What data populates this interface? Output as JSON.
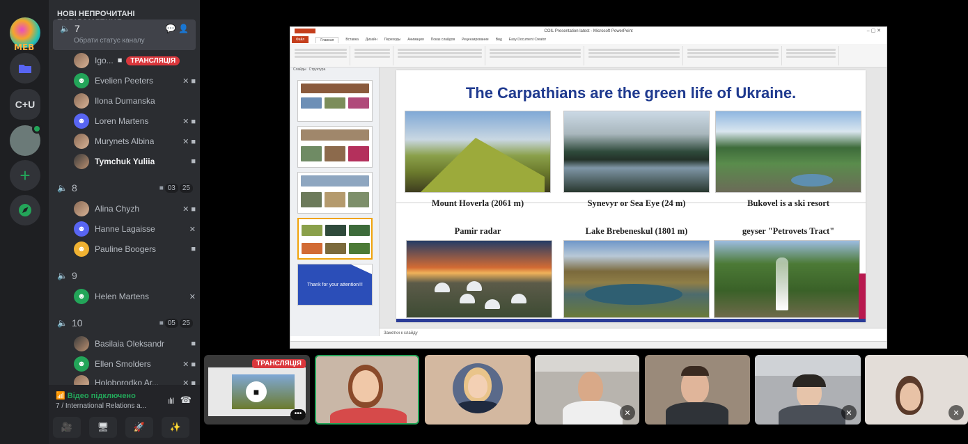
{
  "servers": [
    {
      "label": "MEB",
      "icon": "meb-server-icon"
    },
    {
      "label": "",
      "icon": "folder-icon"
    },
    {
      "label": "C+U",
      "icon": "cu-server-icon"
    },
    {
      "label": "",
      "icon": "image-server-icon"
    },
    {
      "label": "+",
      "icon": "add-server-icon"
    },
    {
      "label": "",
      "icon": "explore-icon"
    }
  ],
  "sidebar": {
    "unread_banner": "НОВІ НЕПРОЧИТАНІ ПОВІДОМЛЕННЯ",
    "channels": [
      {
        "name": "7",
        "status": "Обрати статус каналу",
        "users": [
          {
            "name": "Igo...",
            "live": "ТРАНСЛЯЦІЯ"
          },
          {
            "name": "Evelien Peeters"
          },
          {
            "name": "Ilona Dumanska"
          },
          {
            "name": "Loren Martens"
          },
          {
            "name": "Murynets Albina"
          },
          {
            "name": "Tymchuk Yuliia"
          }
        ]
      },
      {
        "name": "8",
        "video_count": "03",
        "limit": "25",
        "users": [
          {
            "name": "Alina Chyzh"
          },
          {
            "name": "Hanne Lagaisse"
          },
          {
            "name": "Pauline Boogers"
          }
        ]
      },
      {
        "name": "9",
        "users": [
          {
            "name": "Helen Martens"
          }
        ]
      },
      {
        "name": "10",
        "video_count": "05",
        "limit": "25",
        "users": [
          {
            "name": "Basilaia Oleksandr"
          },
          {
            "name": "Ellen Smolders"
          },
          {
            "name": "Holoborodko Ar..."
          }
        ]
      }
    ]
  },
  "voice_panel": {
    "title": "Відео підключено",
    "subtitle": "7 / International Relations a..."
  },
  "ppt": {
    "window_title": "COIL Presentation latest - Microsoft PowerPoint",
    "tabs": [
      "Файл",
      "Главная",
      "Вставка",
      "Дизайн",
      "Переходы",
      "Анимация",
      "Показ слайдов",
      "Рецензирование",
      "Вид",
      "Easy Document Creator"
    ],
    "thumb_tabs": [
      "Слайды",
      "Структура"
    ],
    "last_thumb_text": "Thank for your attention!!!",
    "notes_placeholder": "Заметки к слайду",
    "slide": {
      "title": "The Carpathians are the green life of Ukraine.",
      "captions": [
        "Mount Hoverla (2061 m)",
        "Synevyr or Sea Eye (24 m)",
        "Bukovel is a ski resort",
        "Pamir radar",
        "Lake Brebeneskul (1801 m)",
        "geyser \"Petrovets Tract\""
      ]
    }
  },
  "stream_tile": {
    "live": "ТРАНСЛЯЦІЯ"
  },
  "colors": {
    "green": "#23a559",
    "live_red": "#da373c",
    "slide_title": "#1f3a8f"
  }
}
